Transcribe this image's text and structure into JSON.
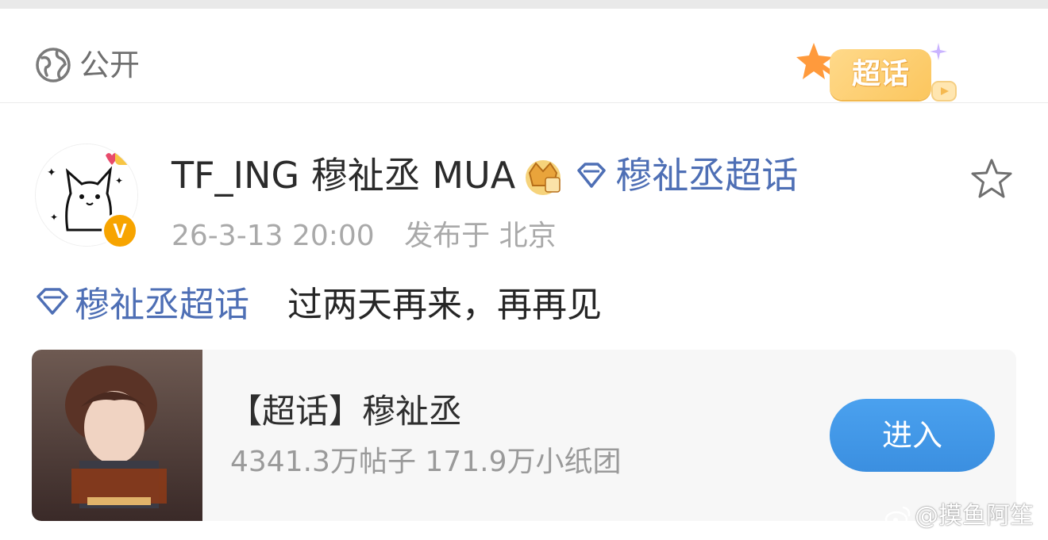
{
  "visibility": {
    "icon": "globe-icon",
    "label": "公开"
  },
  "super_topic_badge": {
    "text": "超话",
    "color": "#fbc65e"
  },
  "author": {
    "name": "TF_ING 穆祉丞 MUA",
    "crown_icon": "crown-icon",
    "topic_icon": "diamond-topic-icon",
    "topic_link": "穆祉丞超话",
    "verified_badge": "V"
  },
  "meta": {
    "time": "26-3-13 20:00",
    "location": "发布于 北京"
  },
  "post": {
    "topic": "穆祉丞超话",
    "text": "过两天再来，再再见"
  },
  "topic_card": {
    "title": "【超话】穆祉丞",
    "stats": "4341.3万帖子 171.9万小纸团",
    "enter_label": "进入",
    "button_color": "#3b8fe0"
  },
  "watermark": "@摸鱼阿笙",
  "colors": {
    "link": "#4e6fb5",
    "muted": "#a9a9a9"
  }
}
